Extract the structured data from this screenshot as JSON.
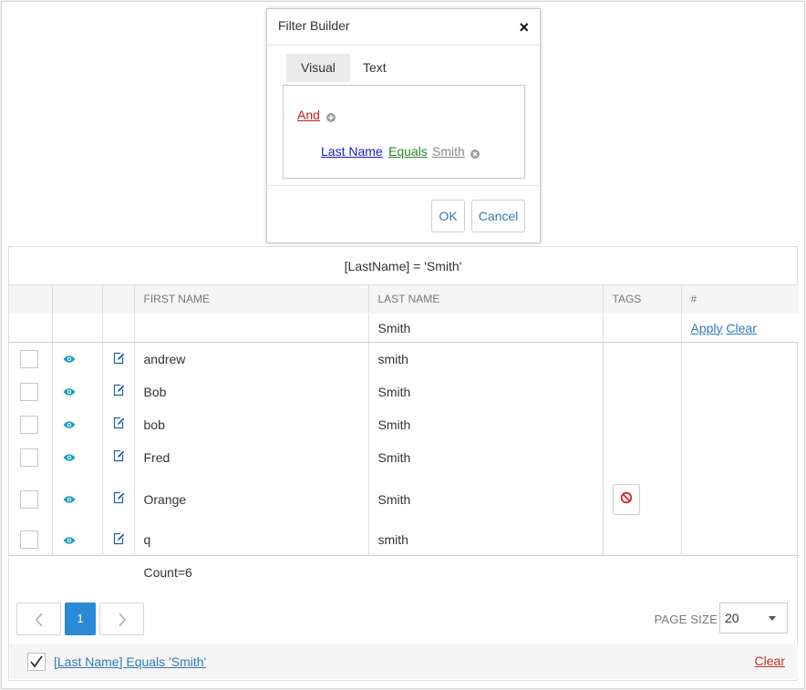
{
  "dialog": {
    "title": "Filter Builder",
    "close_glyph": "×",
    "tabs": [
      {
        "label": "Visual",
        "active": true
      },
      {
        "label": "Text",
        "active": false
      }
    ],
    "builder": {
      "group_operator": "And",
      "condition": {
        "field": "Last Name",
        "operator": "Equals",
        "value": "Smith"
      }
    },
    "ok_label": "OK",
    "cancel_label": "Cancel"
  },
  "grid": {
    "filter_expression": "[LastName] = 'Smith'",
    "columns": [
      "",
      "",
      "",
      "FIRST NAME",
      "LAST NAME",
      "TAGS",
      "#"
    ],
    "filter_row": {
      "last_name": "Smith",
      "apply_label": "Apply",
      "clear_label": "Clear"
    },
    "rows": [
      {
        "first_name": "andrew",
        "last_name": "smith",
        "has_tag_button": false
      },
      {
        "first_name": "Bob",
        "last_name": "Smith",
        "has_tag_button": false
      },
      {
        "first_name": "bob",
        "last_name": "Smith",
        "has_tag_button": false
      },
      {
        "first_name": "Fred",
        "last_name": "Smith",
        "has_tag_button": false
      },
      {
        "first_name": "Orange",
        "last_name": "Smith",
        "has_tag_button": true
      },
      {
        "first_name": "q",
        "last_name": "smith",
        "has_tag_button": false
      }
    ],
    "count_text": "Count=6"
  },
  "pager": {
    "prev_glyph": "‹",
    "current_page": "1",
    "next_glyph": "›",
    "page_size_label": "PAGE SIZE",
    "page_size_value": "20"
  },
  "status_bar": {
    "filter_text": "[Last Name] Equals 'Smith'",
    "clear_label": "Clear",
    "checked": true
  },
  "colors": {
    "accent": "#2a8ad8",
    "link": "#337ab7",
    "and_red": "#c21d1d",
    "field_blue": "#1a1ac9",
    "op_green": "#2a8a2a",
    "eye_teal": "#1b9bbf",
    "ban_red": "#d9232e"
  }
}
